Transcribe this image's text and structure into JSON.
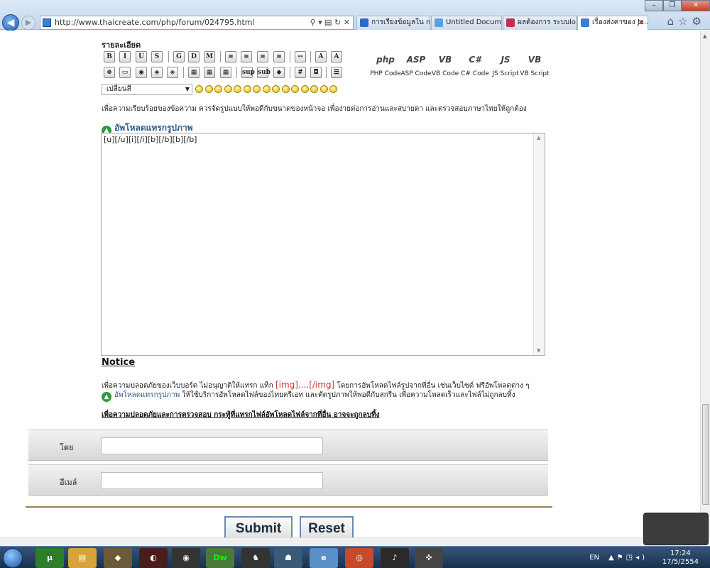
{
  "browser": {
    "url": "http://www.thaicreate.com/php/forum/024795.html",
    "tabs": [
      {
        "label": "การเรียงข้อมูลใน m...",
        "active": false,
        "color": "#2c6ac8"
      },
      {
        "label": "Untitled Document",
        "active": false,
        "color": "#5aa0e0"
      },
      {
        "label": "ผลต้องการ ระบบlog...",
        "active": false,
        "color": "#c03050"
      },
      {
        "label": "เรื่องส่งค่าของ Ja...",
        "active": true,
        "color": "#3a7fd0"
      }
    ]
  },
  "editor": {
    "detail_label": "รายละเอียด",
    "format_row1": [
      "B",
      "I",
      "U",
      "S",
      "G",
      "D",
      "M",
      "≡",
      "≡",
      "≡",
      "≡",
      "↔",
      "A",
      "A"
    ],
    "format_row2": [
      "⊛",
      "▭",
      "◉",
      "◈",
      "◈",
      "▦",
      "▦",
      "▦",
      "sup",
      "sub",
      "◆",
      "#",
      "◘",
      "☰"
    ],
    "code_buttons": [
      {
        "icon": "php",
        "label": "PHP Code"
      },
      {
        "icon": "ASP",
        "label": "ASP Code"
      },
      {
        "icon": "VB",
        "label": "VB Code"
      },
      {
        "icon": "C#",
        "label": "C# Code"
      },
      {
        "icon": "JS",
        "label": "JS Script"
      },
      {
        "icon": "VB",
        "label": "VB Script"
      }
    ],
    "font_select": "เปลี่ยนสี",
    "smiley_count": 15,
    "hint": "เพื่อความเรียบร้อยของข้อความ ควรจัดรูปแบบให้พอดีกับขนาดของหน้าจอ เพื่อง่ายต่อการอ่านและสบายตา และตรวจสอบภาษาไทยให้ถูกต้อง",
    "upload_link": "อัพโหลดแทรกรูปภาพ",
    "textarea_value": "[u][/u][i][/i][b][/b][b][/b]"
  },
  "notice": {
    "title": "Notice",
    "line1_prefix": "เพื่อความปลอดภัยของเว็บบอร์ด ไม่อนุญาติให้แทรก แท็ก",
    "img_tag": "[img]....[/img]",
    "line1_suffix": "โดยการอัพโหลดไฟล์รูปจากที่อื่น เช่นเว็บไซต์ ฟรีอัพโหลดต่าง ๆ",
    "line2_link": "อัพโหลดแทรกรูปภาพ",
    "line2_text": "ให้ใช้บริการอัพโหลดไฟล์ของไทยครีเอท และตัดรูปภาพให้พอดีกับสกรีน เพื่อความโหลดเร็วและไฟล์ไม่ถูกลบทิ้ง",
    "line3": "เพื่อความปลอดภัยและการตรวจสอบ กระทู้ที่แทรกไฟล์อัพโหลดไฟล์จากที่อื่น อาจจะถูกลบทิ้ง"
  },
  "form": {
    "by_label": "โดย",
    "by_value": "",
    "email_label": "อีเมล์",
    "email_value": "",
    "submit_label": "Submit",
    "reset_label": "Reset"
  },
  "taskbar": {
    "lang": "EN",
    "time": "17:24",
    "date": "17/5/2554"
  }
}
